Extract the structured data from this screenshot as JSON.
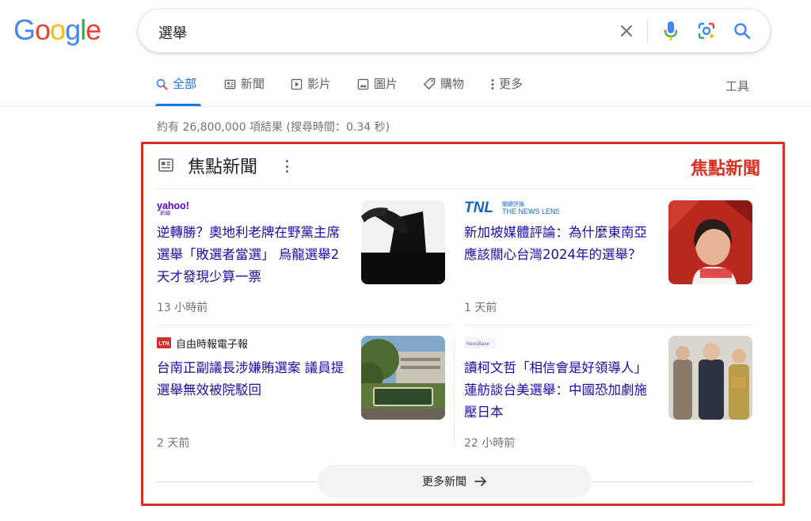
{
  "logo": {
    "letters": [
      "G",
      "o",
      "o",
      "g",
      "l",
      "e"
    ],
    "colors": [
      "#4285f4",
      "#ea4335",
      "#fbbc05",
      "#4285f4",
      "#34a853",
      "#ea4335"
    ]
  },
  "search": {
    "query": "選舉",
    "icons": [
      "close-icon",
      "mic-icon",
      "lens-icon",
      "search-icon"
    ]
  },
  "tabs": [
    {
      "label": "全部",
      "icon": "search-icon",
      "active": true
    },
    {
      "label": "新聞",
      "icon": "news-icon"
    },
    {
      "label": "影片",
      "icon": "video-icon"
    },
    {
      "label": "圖片",
      "icon": "image-icon"
    },
    {
      "label": "購物",
      "icon": "tag-icon"
    },
    {
      "label": "更多",
      "icon": "more-vert-icon"
    }
  ],
  "tools_label": "工具",
  "result_stats": "約有 26,800,000 項結果 (搜尋時間：0.34 秒)",
  "top_stories": {
    "title": "焦點新聞",
    "annotation_label": "焦點新聞",
    "more_button": "更多新聞",
    "stories": [
      {
        "source": "yahoo!",
        "source_sub": "新聞",
        "headline": "逆轉勝？奧地利老牌在野黨主席選舉「敗選者當選」 烏龍選舉2天才發現少算一票",
        "time": "13 小時前"
      },
      {
        "source": "THE NEWS LENS",
        "source_sub": "關鍵評論",
        "source_mark": "TNL",
        "headline": "新加坡媒體評論：為什麼東南亞應該關心台灣2024年的選舉？",
        "time": "1 天前"
      },
      {
        "source": "自由時報電子報",
        "source_mark": "LTN",
        "headline": "台南正副議長涉嫌賄選案 議員提選舉無效被院駁回",
        "time": "2 天前"
      },
      {
        "source": "NewsBase",
        "headline": "讀柯文哲「相信會是好領導人」 蓮舫談台美選舉：中國恐加劇施壓日本",
        "time": "22 小時前"
      }
    ]
  },
  "colors": {
    "link": "#1a0dab",
    "accent": "#1a73e8",
    "annotation": "#d93025"
  }
}
